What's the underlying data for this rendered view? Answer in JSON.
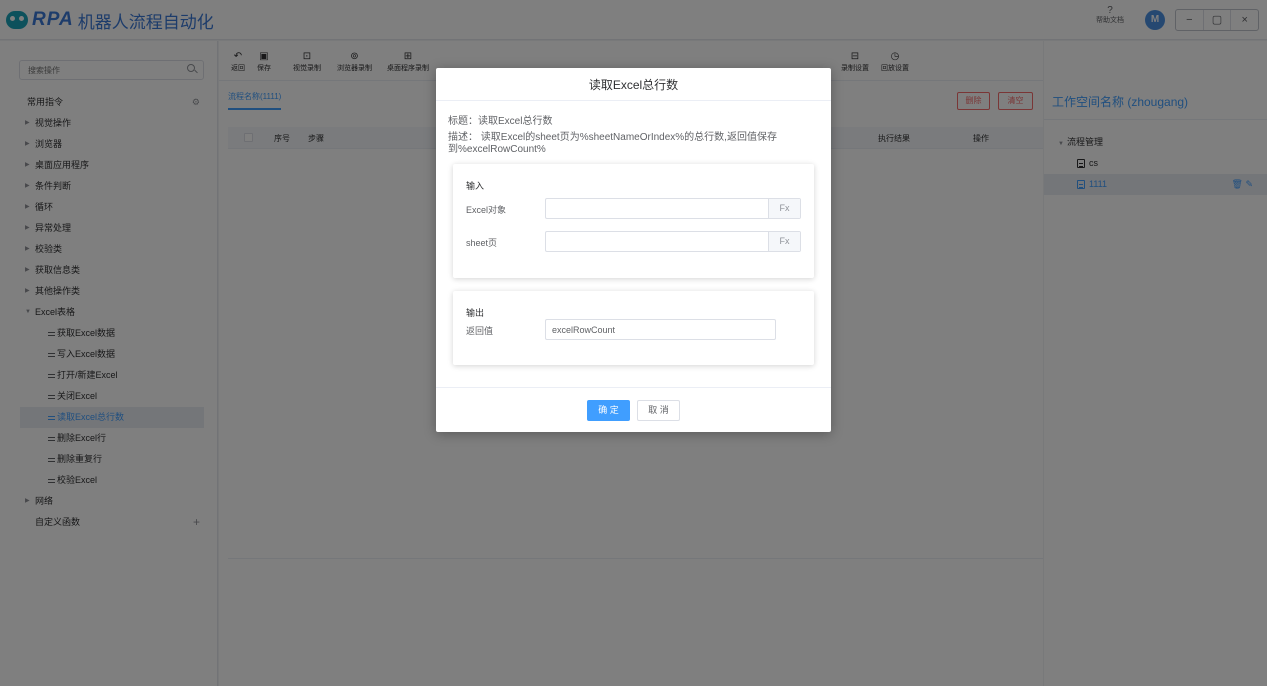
{
  "app": {
    "logo_text": "RPA",
    "title": "机器人流程自动化",
    "help_label": "帮助文档",
    "help_icon": "?",
    "avatar_letter": "M",
    "window_buttons": [
      "−",
      "▢",
      "×"
    ]
  },
  "sidebar": {
    "search_placeholder": "搜索操作",
    "items": [
      {
        "label": "常用指令"
      },
      {
        "label": "视觉操作"
      },
      {
        "label": "浏览器"
      },
      {
        "label": "桌面应用程序"
      },
      {
        "label": "条件判断"
      },
      {
        "label": "循环"
      },
      {
        "label": "异常处理"
      },
      {
        "label": "校验类"
      },
      {
        "label": "获取信息类"
      },
      {
        "label": "其他操作类"
      },
      {
        "label": "Excel表格"
      },
      {
        "label": "获取Excel数据"
      },
      {
        "label": "写入Excel数据"
      },
      {
        "label": "打开/新建Excel"
      },
      {
        "label": "关闭Excel"
      },
      {
        "label": "读取Excel总行数"
      },
      {
        "label": "删除Excel行"
      },
      {
        "label": "删除重复行"
      },
      {
        "label": "校验Excel"
      },
      {
        "label": "网络"
      },
      {
        "label": "自定义函数"
      }
    ]
  },
  "toolbar": {
    "items": [
      {
        "label": "返回",
        "icon": "↶"
      },
      {
        "label": "保存",
        "icon": "▣"
      },
      {
        "label": "视觉录制",
        "icon": "⊡"
      },
      {
        "label": "浏览器录制",
        "icon": "⊚"
      },
      {
        "label": "桌面程序录制",
        "icon": "⊞"
      },
      {
        "label": "录制设置",
        "icon": "⊟"
      },
      {
        "label": "回放设置",
        "icon": "◷"
      }
    ]
  },
  "main": {
    "tab": "流程名称(1111)",
    "delete_label": "删除",
    "clear_label": "清空",
    "columns": {
      "index": "序号",
      "step": "步骤",
      "result": "执行结果",
      "action": "操作"
    }
  },
  "workspace": {
    "title": "工作空间名称 (zhougang)",
    "root": "流程管理",
    "children": [
      "cs",
      "1111"
    ]
  },
  "dialog": {
    "title": "读取Excel总行数",
    "label_line": "标题：读取Excel总行数",
    "desc_line": "描述： 读取Excel的sheet页为%sheetNameOrIndex%的总行数,返回值保存到%excelRowCount%",
    "input_header": "输入",
    "excel_label": "Excel对象",
    "sheet_label": "sheet页",
    "fx_label": "Fx",
    "output_header": "输出",
    "return_label": "返回值",
    "return_value": "excelRowCount",
    "ok_label": "确 定",
    "cancel_label": "取 消"
  }
}
